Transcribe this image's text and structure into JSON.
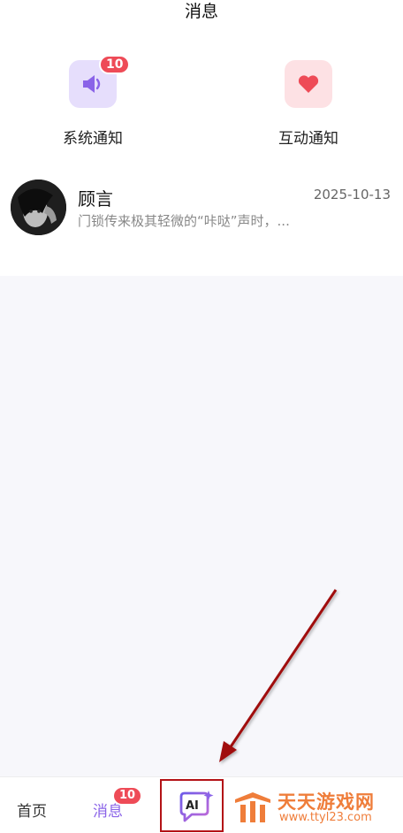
{
  "header": {
    "title": "消息"
  },
  "notices": {
    "system": {
      "label": "系统通知",
      "badge": "10",
      "icon": "speaker-icon",
      "icon_color": "#8a63e8"
    },
    "interaction": {
      "label": "互动通知",
      "icon": "heart-icon",
      "icon_color": "#ee4b57"
    }
  },
  "conversation": {
    "name": "顾言",
    "time": "2025-10-13",
    "preview": "门锁传来极其轻微的“咔哒”声时，..."
  },
  "tabbar": {
    "home": "首页",
    "messages": "消息",
    "messages_badge": "10",
    "ai_label": "AI"
  },
  "watermark": {
    "cn": "天天游戏网",
    "url": "www.ttyl23.com"
  },
  "colors": {
    "accent": "#8a63e8",
    "badge": "#ee4b57",
    "highlight": "#b31216",
    "watermark": "#ef7d3a"
  }
}
